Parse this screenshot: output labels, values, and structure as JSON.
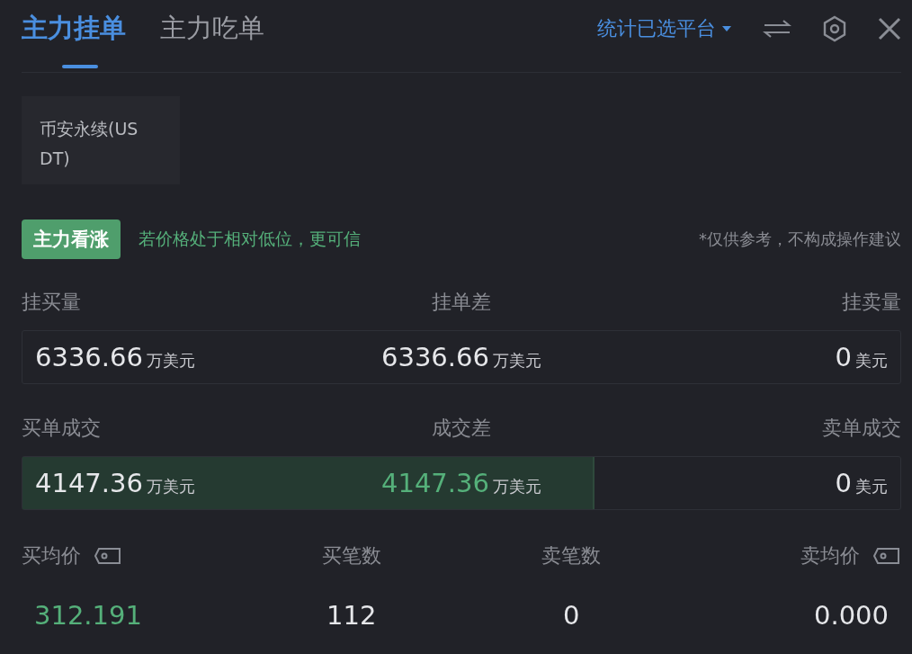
{
  "tabs": [
    {
      "label": "主力挂单",
      "selected": true
    },
    {
      "label": "主力吃单",
      "selected": false
    }
  ],
  "platform_filter": {
    "label": "统计已选平台"
  },
  "platform_chip": {
    "label": "币安永续(USDT)"
  },
  "signal": {
    "badge": "主力看涨",
    "hint": "若价格处于相对低位，更可信",
    "disclaimer": "*仅供参考，不构成操作建议"
  },
  "sections": [
    {
      "labels": [
        "挂买量",
        "挂单差",
        "挂卖量"
      ],
      "cells": [
        {
          "value": "6336.66",
          "unit": "万美元",
          "color": "#e6e7ea"
        },
        {
          "value": "6336.66",
          "unit": "万美元",
          "color": "#e6e7ea"
        },
        {
          "value": "0",
          "unit": "美元",
          "color": "#e6e7ea"
        }
      ]
    },
    {
      "labels": [
        "买单成交",
        "成交差",
        "卖单成交"
      ],
      "level": 0.65,
      "cells": [
        {
          "value": "4147.36",
          "unit": "万美元",
          "color": "#e6e7ea"
        },
        {
          "value": "4147.36",
          "unit": "万美元",
          "color": "#55b07a"
        },
        {
          "value": "0",
          "unit": "美元",
          "color": "#e6e7ea"
        }
      ]
    }
  ],
  "averages": [
    {
      "label": "买均价",
      "value": "312.191",
      "kind": "price",
      "color": "#55b07a"
    },
    {
      "label": "买笔数",
      "value": "112",
      "kind": "count",
      "color": "#e6e7ea"
    },
    {
      "label": "卖笔数",
      "value": "0",
      "kind": "count",
      "color": "#e6e7ea"
    },
    {
      "label": "卖均价",
      "value": "0.000",
      "kind": "price",
      "color": "#e6e7ea"
    }
  ]
}
